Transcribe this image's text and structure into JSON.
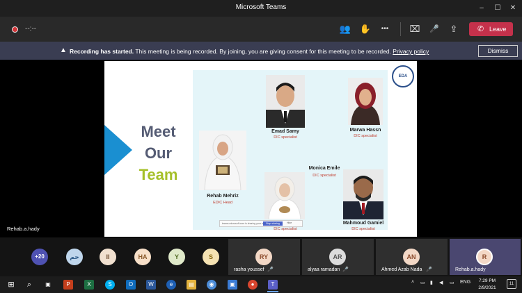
{
  "window": {
    "title": "Microsoft Teams",
    "minimize": "–",
    "maximize": "☐",
    "close": "✕"
  },
  "meeting": {
    "timer": "--:--",
    "leave_label": "Leave",
    "controls": {
      "participants": "👥",
      "raise_hand": "✋",
      "more": "•••",
      "camera_off": "⌧",
      "mic_off": "🎤",
      "share": "⇪",
      "phone": "✆"
    }
  },
  "notice": {
    "icon": "▲",
    "bold": "Recording has started.",
    "text": " This meeting is being recorded. By joining, you are giving consent for this meeting to be recorded. ",
    "link": "Privacy policy",
    "dismiss_label": "Dismiss"
  },
  "slide": {
    "meet_lines": [
      "Meet",
      "Our"
    ],
    "team_word": "Team",
    "logo_text": "EDA",
    "members": [
      {
        "name": "Emad Samy",
        "role": "DIC specialist"
      },
      {
        "name": "Marwa Hassn",
        "role": "DIC specialist"
      },
      {
        "name": "Monica Emile",
        "role": "DIC specialist"
      },
      {
        "name": "Rehab Mehriz",
        "role": "EDIC Head"
      },
      {
        "name": "",
        "role": "DIC specialist"
      },
      {
        "name": "Mahmoud Gamiel",
        "role": "DIC specialist"
      }
    ],
    "share_tip": {
      "text": "teams.microsoft.com is sharing your screen.",
      "stop": "Stop sharing",
      "hide": "Hide"
    }
  },
  "presenter_name": "Rehab.a.hady",
  "gallery": {
    "overflow": "+20",
    "avatars": [
      {
        "initials": "حم",
        "bg": "#bfd6ec",
        "fg": "#2f5c8a"
      },
      {
        "initials": "II",
        "bg": "#f1e0cf",
        "fg": "#6b4a2e"
      },
      {
        "initials": "HA",
        "bg": "#f7dfc8",
        "fg": "#8a5a2b"
      },
      {
        "initials": "Y",
        "bg": "#dfe9c9",
        "fg": "#4f6a22"
      },
      {
        "initials": "S",
        "bg": "#f6e3b3",
        "fg": "#8a6a14"
      }
    ],
    "tiles": [
      {
        "initials": "RY",
        "name": "rasha youssef",
        "bg": "#f3d8c6",
        "fg": "#8b4a2b"
      },
      {
        "initials": "AR",
        "name": "alyaa ramadan",
        "bg": "#dcdcdc",
        "fg": "#555"
      },
      {
        "initials": "AN",
        "name": "Ahmed Azab Nada",
        "bg": "#f3d8c6",
        "fg": "#8b4a2b"
      },
      {
        "initials": "R",
        "name": "Rehab.a.hady",
        "bg": "#f3d8c6",
        "fg": "#8b4a2b"
      }
    ]
  },
  "taskbar": {
    "start": "⊞",
    "search": "⌕",
    "taskview": "▣",
    "apps": [
      {
        "name": "P",
        "bg": "#c43e1c"
      },
      {
        "name": "X",
        "bg": "#1d6f42"
      },
      {
        "name": "S",
        "bg": "#00aff0"
      },
      {
        "name": "O",
        "bg": "#0f6cbd"
      },
      {
        "name": "W",
        "bg": "#2b579a"
      },
      {
        "name": "e",
        "bg": "#1e5fb3"
      },
      {
        "name": "▤",
        "bg": "#e3b23c"
      },
      {
        "name": "◉",
        "bg": "#4b8bd6"
      },
      {
        "name": "▣",
        "bg": "#3a7bd5"
      },
      {
        "name": "●",
        "bg": "#d9462f"
      },
      {
        "name": "T",
        "bg": "#5b5fc7"
      }
    ],
    "tray": {
      "chevron": "˄",
      "network": "▭",
      "battery": "▮",
      "volume": "◀",
      "lang": "ENG"
    },
    "time": "7:29 PM",
    "date": "2/9/2021",
    "notify": "11"
  }
}
